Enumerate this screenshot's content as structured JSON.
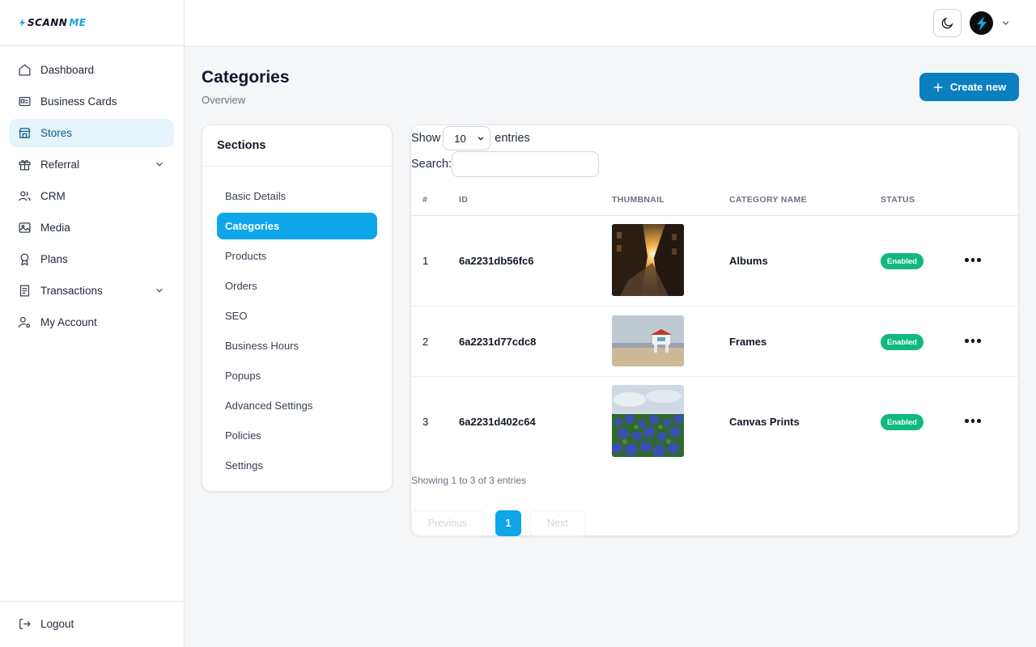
{
  "brand": {
    "name_a": "SCANN",
    "name_b": "ME",
    "accent": "#1aa2e0"
  },
  "sidebar": {
    "items": [
      {
        "label": "Dashboard",
        "icon": "home-icon"
      },
      {
        "label": "Business Cards",
        "icon": "id-card-icon"
      },
      {
        "label": "Stores",
        "icon": "store-icon",
        "active": true
      },
      {
        "label": "Referral",
        "icon": "gift-icon",
        "expandable": true
      },
      {
        "label": "CRM",
        "icon": "users-icon"
      },
      {
        "label": "Media",
        "icon": "image-icon"
      },
      {
        "label": "Plans",
        "icon": "award-icon"
      },
      {
        "label": "Transactions",
        "icon": "receipt-icon",
        "expandable": true
      },
      {
        "label": "My Account",
        "icon": "user-cog-icon"
      }
    ],
    "logout": "Logout"
  },
  "header": {
    "title": "Categories",
    "subtitle": "Overview",
    "create_label": "Create new"
  },
  "sections": {
    "title": "Sections",
    "items": [
      "Basic Details",
      "Categories",
      "Products",
      "Orders",
      "SEO",
      "Business Hours",
      "Popups",
      "Advanced Settings",
      "Policies",
      "Settings"
    ],
    "active_index": 1
  },
  "table": {
    "show_label": "Show",
    "entries_label": "entries",
    "page_size": "10",
    "search_label": "Search:",
    "search_value": "",
    "columns": [
      "#",
      "ID",
      "THUMBNAIL",
      "CATEGORY NAME",
      "STATUS"
    ],
    "rows": [
      {
        "num": "1",
        "id": "6a2231db56fc6",
        "name": "Albums",
        "status": "Enabled",
        "thumb": "city-street-sunset"
      },
      {
        "num": "2",
        "id": "6a2231d77cdc8",
        "name": "Frames",
        "status": "Enabled",
        "thumb": "lifeguard-tower-beach"
      },
      {
        "num": "3",
        "id": "6a2231d402c64",
        "name": "Canvas Prints",
        "status": "Enabled",
        "thumb": "bluebonnet-field"
      }
    ],
    "info": "Showing 1 to 3 of 3 entries",
    "pager": {
      "previous": "Previous",
      "current": "1",
      "next": "Next"
    }
  },
  "colors": {
    "primary": "#0a7fc0",
    "active_section": "#0ea5e9",
    "status_enabled": "#10b981",
    "nav_active_bg": "#e5f3fb"
  }
}
